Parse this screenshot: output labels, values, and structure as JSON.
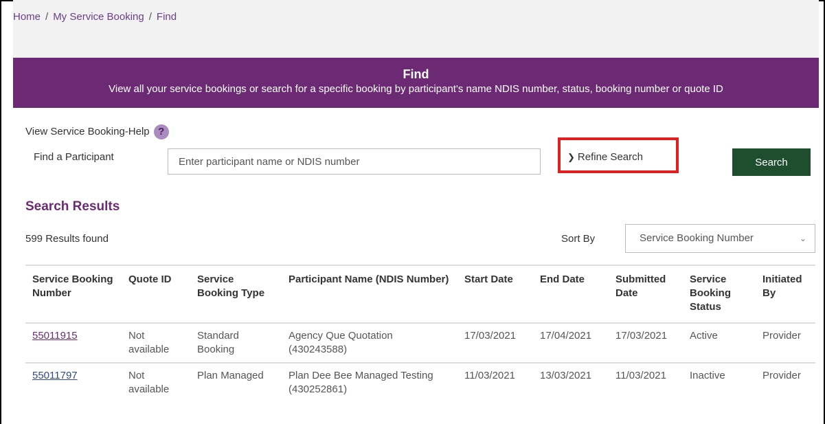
{
  "breadcrumb": {
    "home": "Home",
    "sep": "/",
    "item1": "My Service Booking",
    "item2": "Find"
  },
  "banner": {
    "title": "Find",
    "subtitle": "View all your service bookings or search for a specific booking by participant's name NDIS number, status, booking number or quote ID"
  },
  "help": {
    "label": "View Service Booking-Help",
    "icon": "?"
  },
  "find": {
    "label": "Find a Participant",
    "placeholder": "Enter participant name or NDIS number"
  },
  "refine": {
    "label": "Refine Search",
    "icon": "chevron-down-icon"
  },
  "search_button": "Search",
  "results": {
    "title": "Search Results",
    "count": "599 Results found",
    "sort_label": "Sort By",
    "sort_value": "Service Booking Number"
  },
  "table": {
    "headers": {
      "booking_number": "Service Booking Number",
      "quote_id": "Quote ID",
      "booking_type": "Service Booking Type",
      "participant": "Participant Name (NDIS Number)",
      "start_date": "Start Date",
      "end_date": "End Date",
      "submitted": "Submitted Date",
      "status": "Service Booking Status",
      "initiated": "Initiated By"
    },
    "rows": [
      {
        "booking_number": "55011915",
        "quote_id": "Not available",
        "booking_type": "Standard Booking",
        "participant": "Agency Que Quotation (430243588)",
        "start_date": "17/03/2021",
        "end_date": "17/04/2021",
        "submitted": "17/03/2021",
        "status": "Active",
        "initiated": "Provider"
      },
      {
        "booking_number": "55011797",
        "quote_id": "Not available",
        "booking_type": "Plan Managed",
        "participant": "Plan Dee Bee Managed Testing (430252861)",
        "start_date": "11/03/2021",
        "end_date": "13/03/2021",
        "submitted": "11/03/2021",
        "status": "Inactive",
        "initiated": "Provider"
      }
    ]
  },
  "colors": {
    "brand_purple": "#6b2a73",
    "search_green": "#1f4e2e",
    "highlight_red": "#e02020"
  }
}
